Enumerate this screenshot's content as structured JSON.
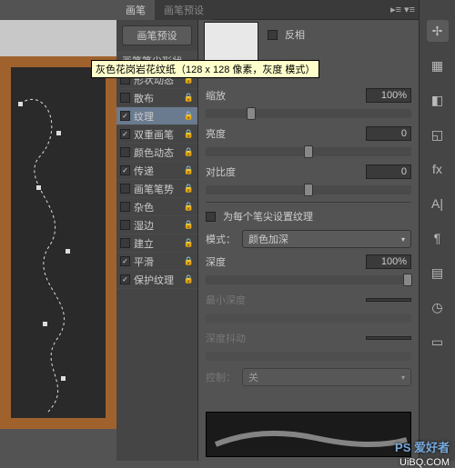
{
  "panel": {
    "tabs": {
      "active": "画笔",
      "inactive": "画笔预设"
    },
    "preset_btn": "画笔预设",
    "shape_head": "画笔笔尖形状",
    "options": [
      {
        "label": "形状动态",
        "checked": false,
        "locked": true
      },
      {
        "label": "散布",
        "checked": false,
        "locked": true
      },
      {
        "label": "纹理",
        "checked": true,
        "locked": true,
        "selected": true
      },
      {
        "label": "双重画笔",
        "checked": true,
        "locked": true
      },
      {
        "label": "颜色动态",
        "checked": false,
        "locked": true
      },
      {
        "label": "传递",
        "checked": true,
        "locked": true
      },
      {
        "label": "画笔笔势",
        "checked": false,
        "locked": true
      },
      {
        "label": "杂色",
        "checked": false,
        "locked": true
      },
      {
        "label": "湿边",
        "checked": false,
        "locked": true
      },
      {
        "label": "建立",
        "checked": false,
        "locked": true
      },
      {
        "label": "平滑",
        "checked": true,
        "locked": true
      },
      {
        "label": "保护纹理",
        "checked": true,
        "locked": true
      }
    ]
  },
  "texture": {
    "invert_label": "反相",
    "tooltip": "灰色花岗岩花纹纸（128 x 128 像素，灰度 模式）",
    "scale_label": "缩放",
    "scale_value": "100%",
    "brightness_label": "亮度",
    "brightness_value": "0",
    "contrast_label": "对比度",
    "contrast_value": "0",
    "per_tip_label": "为每个笔尖设置纹理",
    "mode_label": "模式：",
    "mode_value": "颜色加深",
    "depth_label": "深度",
    "depth_value": "100%",
    "min_depth_label": "最小深度",
    "depth_jitter_label": "深度抖动",
    "control_label": "控制：",
    "control_value": "关"
  },
  "watermark": {
    "brand": "PS 爱好者",
    "url": "UiBQ.COM"
  }
}
